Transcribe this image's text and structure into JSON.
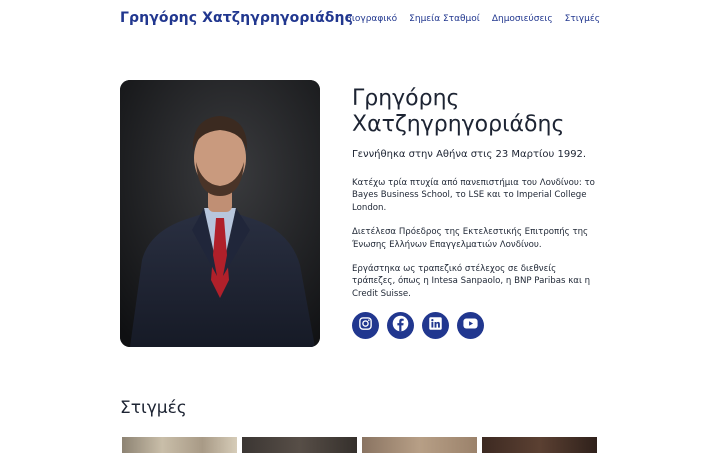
{
  "header": {
    "site_title": "Γρηγόρης Χατζηγρηγοριάδης",
    "nav": [
      {
        "label": "Βιογραφικό"
      },
      {
        "label": "Σημεία Σταθμοί"
      },
      {
        "label": "Δημοσιεύσεις"
      },
      {
        "label": "Στιγμές"
      }
    ]
  },
  "profile": {
    "name_line1": "Γρηγόρης",
    "name_line2": "Χατζηγρηγοριάδης",
    "birth": "Γεννήθηκα στην Αθήνα στις 23 Μαρτίου 1992.",
    "paragraphs": [
      "Κατέχω τρία πτυχία από πανεπιστήμια του Λονδίνου: το Bayes Business School, το LSE και το Imperial College London.",
      "Διετέλεσα Πρόεδρος της Εκτελεστικής Επιτροπής της Ένωσης Ελλήνων Επαγγελματιών Λονδίνου.",
      "Εργάστηκα ως τραπεζικό στέλεχος σε διεθνείς τράπεζες, όπως η Intesa Sanpaolo, η BNP Paribas και η Credit Suisse."
    ]
  },
  "socials": [
    {
      "icon": "instagram-icon"
    },
    {
      "icon": "facebook-icon"
    },
    {
      "icon": "linkedin-icon"
    },
    {
      "icon": "youtube-icon"
    }
  ],
  "moments": {
    "title": "Στιγμές"
  },
  "colors": {
    "accent": "#21378f",
    "text": "#1d2433",
    "background": "#ffffff"
  }
}
